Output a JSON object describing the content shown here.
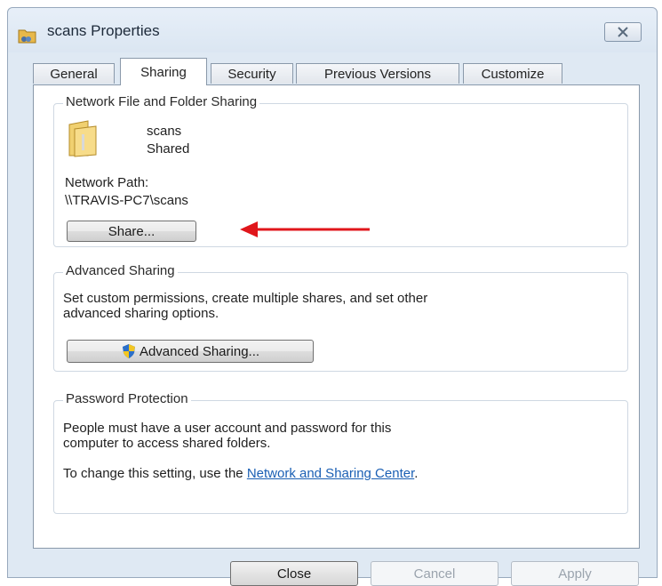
{
  "window": {
    "title": "scans Properties"
  },
  "tabs": [
    {
      "label": "General",
      "active": false
    },
    {
      "label": "Sharing",
      "active": true
    },
    {
      "label": "Security",
      "active": false
    },
    {
      "label": "Previous Versions",
      "active": false
    },
    {
      "label": "Customize",
      "active": false
    }
  ],
  "network_sharing": {
    "title": "Network File and Folder Sharing",
    "folder_name": "scans",
    "folder_status": "Shared",
    "path_label": "Network Path:",
    "path_value": "\\\\TRAVIS-PC7\\scans",
    "share_button": "Share..."
  },
  "advanced_sharing": {
    "title": "Advanced Sharing",
    "description_line1": "Set custom permissions, create multiple shares, and set other",
    "description_line2": "advanced sharing options.",
    "button": "Advanced Sharing..."
  },
  "password_protection": {
    "title": "Password Protection",
    "line1": "People must have a user account and password for this",
    "line2": "computer to access shared folders.",
    "change_prefix": "To change this setting, use the ",
    "link_text": "Network and Sharing Center",
    "change_suffix": "."
  },
  "footer": {
    "close": "Close",
    "cancel": "Cancel",
    "apply": "Apply"
  },
  "colors": {
    "annotation_arrow": "#e0161b",
    "link": "#1a5fb4"
  }
}
